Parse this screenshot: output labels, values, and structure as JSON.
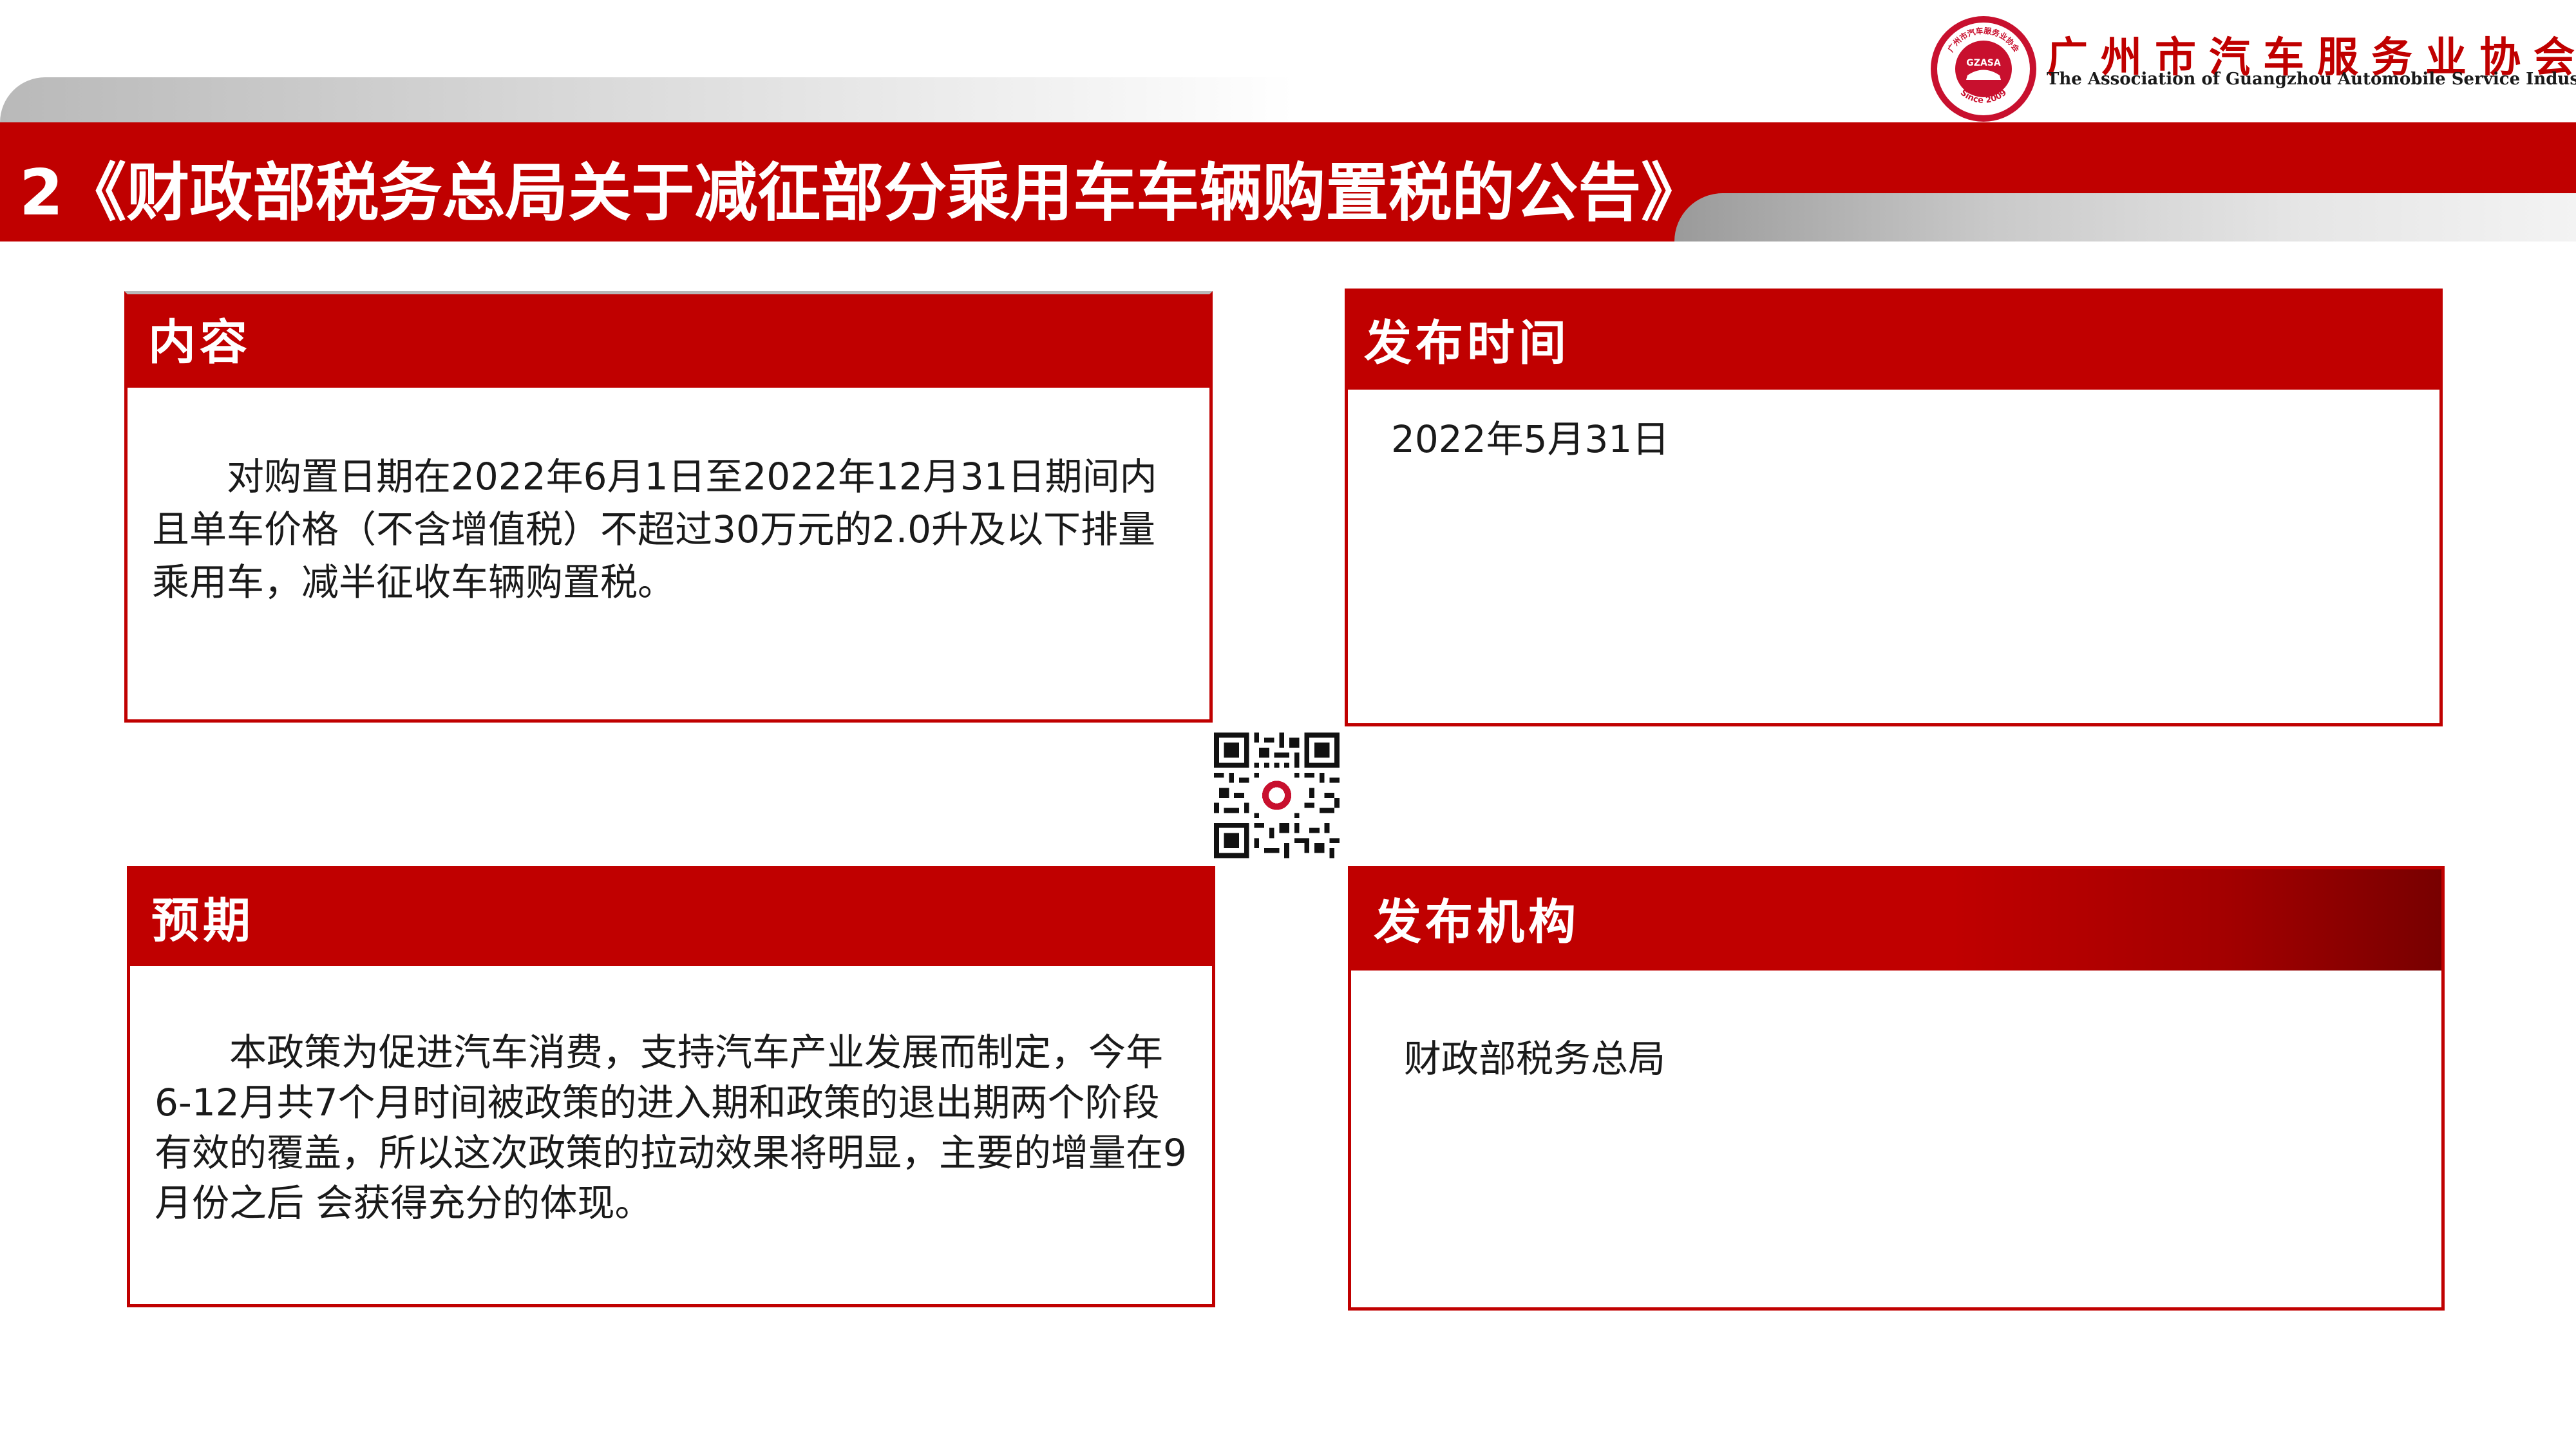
{
  "header": {
    "title": "2《财政部税务总局关于减征部分乘用车车辆购置税的公告》",
    "org_name_cn": "广州市汽车服务业协会",
    "org_name_en": "The Association of Guangzhou Automobile Service Industry",
    "logo": {
      "top_text": "广州市汽车服务业协会",
      "middle_text": "GZASA",
      "bottom_text": "Since 2009"
    }
  },
  "cards": {
    "content": {
      "heading": "内容",
      "text": "对购置日期在2022年6月1日至2022年12月31日期间内且单车价格（不含增值税）不超过30万元的2.0升及以下排量乘用车，减半征收车辆购置税。"
    },
    "release_time": {
      "heading": "发布时间",
      "text": "2022年5月31日"
    },
    "expectation": {
      "heading": "预期",
      "text": "本政策为促进汽车消费，支持汽车产业发展而制定，今年6-12月共7个月时间被政策的进入期和政策的退出期两个阶段有效的覆盖，所以这次政策的拉动效果将明显，主要的增量在9月份之后 会获得充分的体现。"
    },
    "issuer": {
      "heading": "发布机构",
      "text": "财政部税务总局"
    }
  },
  "colors": {
    "brand_red": "#c00000",
    "dark_red": "#780000",
    "text": "#1a1a1a"
  },
  "icons": {
    "logo": "association-seal-icon",
    "qr": "qr-code-icon"
  }
}
